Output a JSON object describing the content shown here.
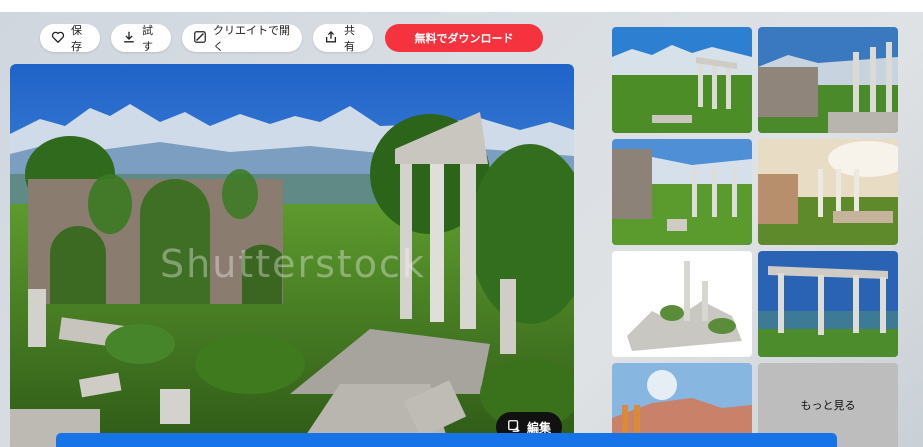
{
  "toolbar": {
    "save_label": "保存",
    "try_label": "試す",
    "create_label": "クリエイトで開く",
    "share_label": "共有",
    "download_label": "無料でダウンロード"
  },
  "main_image": {
    "watermark": "Shutterstock",
    "edit_label": "編集"
  },
  "more_label": "もっと見る",
  "colors": {
    "download_button": "#f5333f",
    "bottom_bar": "#1774e8"
  }
}
